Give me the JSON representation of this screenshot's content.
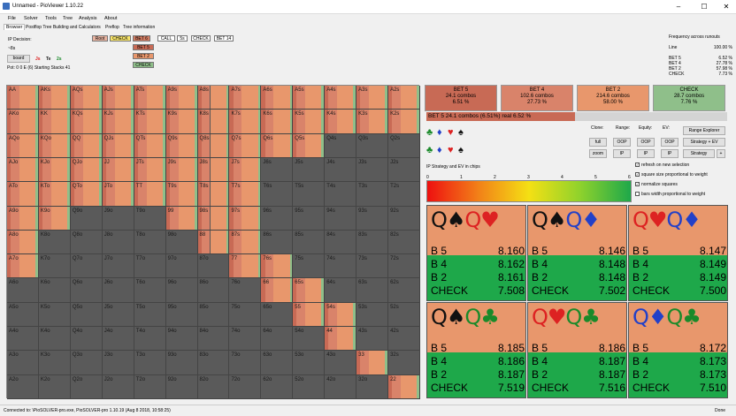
{
  "window": {
    "title": "Unnamed - PioViewer 1.10.22",
    "min": "–",
    "max": "☐",
    "close": "✕"
  },
  "menu": [
    "File",
    "Solver",
    "Tools",
    "Tree",
    "Analysis",
    "About"
  ],
  "tabs": [
    "Browser",
    "Postflop Tree Building and Calculators",
    "Preflop",
    "Tree information"
  ],
  "left_info": {
    "ip_decision": "IP Decision:",
    "path": "~8s",
    "board_btn": "board",
    "board_cards": [
      "Js",
      "Te",
      "2s"
    ],
    "pot": "Pot: 0 0 E (6) Starting Stacks 41"
  },
  "tree_chips": [
    {
      "label": "Root",
      "color": "#e8b3a0"
    },
    {
      "label": "CHECK",
      "color": "#f7e46a"
    },
    {
      "label": "BET 6",
      "color": "#d07a60"
    },
    {
      "label": "CALL",
      "color": "#ffffff"
    },
    {
      "label": "5s",
      "color": "#ffffff"
    },
    {
      "label": "CHECK",
      "color": "#ffffff"
    },
    {
      "label": "BET 14",
      "color": "#ffffff"
    }
  ],
  "tree_sub_chips": [
    {
      "label": "BET 5",
      "color": "#c86a55"
    },
    {
      "label": "BET 2",
      "color": "#e8976c"
    },
    {
      "label": "CHECK",
      "color": "#8fbf8a"
    }
  ],
  "freq": {
    "title": "Frequency across runouts",
    "line_label": "Line",
    "line_value": "100.00 %",
    "rows": [
      {
        "label": "BET 5",
        "value": "6.52 %"
      },
      {
        "label": "BET 4",
        "value": "27.78 %"
      },
      {
        "label": "BET 2",
        "value": "57.98 %"
      },
      {
        "label": "CHECK",
        "value": "7.73 %"
      }
    ]
  },
  "grid": {
    "ranks": [
      "A",
      "K",
      "Q",
      "J",
      "T",
      "9",
      "8",
      "7",
      "6",
      "5",
      "4",
      "3",
      "2"
    ],
    "cells": [
      [
        "AA",
        "AKs",
        "AQs",
        "AJs",
        "ATs",
        "A9s",
        "A8s",
        "A7s",
        "A6s",
        "A5s",
        "A4s",
        "A3s",
        "A2s"
      ],
      [
        "AKo",
        "KK",
        "KQs",
        "KJs",
        "KTs",
        "K9s",
        "K8s",
        "K7s",
        "K6s",
        "K5s",
        "K4s",
        "K3s",
        "K2s"
      ],
      [
        "AQo",
        "KQo",
        "QQ",
        "QJs",
        "QTs",
        "Q9s",
        "Q8s",
        "Q7s",
        "Q6s",
        "Q5s",
        "Q4s",
        "Q3s",
        "Q2s"
      ],
      [
        "AJo",
        "KJo",
        "QJo",
        "JJ",
        "JTs",
        "J9s",
        "J8s",
        "J7s",
        "J6s",
        "J5s",
        "J4s",
        "J3s",
        "J2s"
      ],
      [
        "ATo",
        "KTo",
        "QTo",
        "JTo",
        "TT",
        "T9s",
        "T8s",
        "T7s",
        "T6s",
        "T5s",
        "T4s",
        "T3s",
        "T2s"
      ],
      [
        "A9o",
        "K9o",
        "Q9o",
        "J9o",
        "T9o",
        "99",
        "98s",
        "97s",
        "96s",
        "95s",
        "94s",
        "93s",
        "92s"
      ],
      [
        "A8o",
        "K8o",
        "Q8o",
        "J8o",
        "T8o",
        "98o",
        "88",
        "87s",
        "86s",
        "85s",
        "84s",
        "83s",
        "82s"
      ],
      [
        "A7o",
        "K7o",
        "Q7o",
        "J7o",
        "T7o",
        "97o",
        "87o",
        "77",
        "76s",
        "75s",
        "74s",
        "73s",
        "72s"
      ],
      [
        "A6o",
        "K6o",
        "Q6o",
        "J6o",
        "T6o",
        "96o",
        "86o",
        "76o",
        "66",
        "65s",
        "64s",
        "63s",
        "62s"
      ],
      [
        "A5o",
        "K5o",
        "Q5o",
        "J5o",
        "T5o",
        "95o",
        "85o",
        "75o",
        "65o",
        "55",
        "54s",
        "53s",
        "52s"
      ],
      [
        "A4o",
        "K4o",
        "Q4o",
        "J4o",
        "T4o",
        "94o",
        "84o",
        "74o",
        "64o",
        "54o",
        "44",
        "43s",
        "42s"
      ],
      [
        "A3o",
        "K3o",
        "Q3o",
        "J3o",
        "T3o",
        "93o",
        "83o",
        "73o",
        "63o",
        "53o",
        "43o",
        "33",
        "32s"
      ],
      [
        "A2o",
        "K2o",
        "Q2o",
        "J2o",
        "T2o",
        "92o",
        "82o",
        "72o",
        "62o",
        "52o",
        "42o",
        "32o",
        "22"
      ]
    ],
    "fill": [
      [
        1,
        1,
        1,
        1,
        1,
        1,
        1,
        1,
        1,
        1,
        1,
        1,
        1
      ],
      [
        1,
        1,
        1,
        1,
        1,
        1,
        1,
        1,
        1,
        1,
        1,
        1,
        1
      ],
      [
        1,
        1,
        1,
        1,
        1,
        1,
        1,
        1,
        1,
        1,
        0,
        0,
        0
      ],
      [
        1,
        1,
        1,
        1,
        1,
        1,
        1,
        1,
        0,
        0,
        0,
        0,
        0
      ],
      [
        1,
        1,
        1,
        1,
        1,
        1,
        1,
        1,
        0,
        0,
        0,
        0,
        0
      ],
      [
        1,
        1,
        0,
        0,
        0,
        1,
        1,
        1,
        0,
        0,
        0,
        0,
        0
      ],
      [
        1,
        0,
        0,
        0,
        0,
        0,
        1,
        1,
        0,
        0,
        0,
        0,
        0
      ],
      [
        1,
        0,
        0,
        0,
        0,
        0,
        0,
        1,
        1,
        0,
        0,
        0,
        0
      ],
      [
        0,
        0,
        0,
        0,
        0,
        0,
        0,
        0,
        1,
        1,
        0,
        0,
        0
      ],
      [
        0,
        0,
        0,
        0,
        0,
        0,
        0,
        0,
        0,
        1,
        1,
        0,
        0
      ],
      [
        0,
        0,
        0,
        0,
        0,
        0,
        0,
        0,
        0,
        0,
        1,
        0,
        0
      ],
      [
        0,
        0,
        0,
        0,
        0,
        0,
        0,
        0,
        0,
        0,
        0,
        1,
        0
      ],
      [
        0,
        0,
        0,
        0,
        0,
        0,
        0,
        0,
        0,
        0,
        0,
        0,
        1
      ]
    ]
  },
  "actions": [
    {
      "name": "BET 5",
      "combos": "24.1 combos",
      "pct": "6.51 %",
      "color": "#c86a55"
    },
    {
      "name": "BET 4",
      "combos": "102.6 combos",
      "pct": "27.73 %",
      "color": "#d9836a"
    },
    {
      "name": "BET 2",
      "combos": "214.6 combos",
      "pct": "58.00 %",
      "color": "#e8976c"
    },
    {
      "name": "CHECK",
      "combos": "28.7 combos",
      "pct": "7.76 %",
      "color": "#8fbf8a"
    }
  ],
  "combo_bar": "BET 5   24.1 combos (6.51%) real  6.52 %",
  "controls": {
    "labels": [
      "Clone:",
      "Range:",
      "Equity:",
      "EV:"
    ],
    "full": "full",
    "zoom": "zoom",
    "oop1": "OOP",
    "ip1": "IP",
    "oop2": "OOP",
    "ip2": "IP",
    "oop3": "OOP",
    "ip3": "IP",
    "range_explorer": "Range Explorer",
    "strategy_ev": "Strategy + EV",
    "strategy": "Strategy",
    "plus": "+"
  },
  "gradient": {
    "caption": "IP Strategy and EV in chips",
    "ticks": [
      "0",
      "1",
      "2",
      "3",
      "4",
      "5",
      "6"
    ]
  },
  "checkboxes": [
    {
      "label": "refresh on new selection",
      "checked": "✓"
    },
    {
      "label": "square size proportional to weight",
      "checked": "✓"
    },
    {
      "label": "normalize squares",
      "checked": "✓"
    },
    {
      "label": "bars width proportional to weight",
      "checked": ""
    }
  ],
  "combos": [
    {
      "c1": "Q♠",
      "c2": "Q♥",
      "rows": [
        [
          "B 5",
          "8.160"
        ],
        [
          "B 4",
          "8.162"
        ],
        [
          "B 2",
          "8.161"
        ],
        [
          "CHECK",
          "7.508"
        ]
      ]
    },
    {
      "c1": "Q♠",
      "c2": "Q♦",
      "rows": [
        [
          "B 5",
          "8.146"
        ],
        [
          "B 4",
          "8.148"
        ],
        [
          "B 2",
          "8.148"
        ],
        [
          "CHECK",
          "7.502"
        ]
      ]
    },
    {
      "c1": "Q♥",
      "c2": "Q♦",
      "rows": [
        [
          "B 5",
          "8.147"
        ],
        [
          "B 4",
          "8.149"
        ],
        [
          "B 2",
          "8.149"
        ],
        [
          "CHECK",
          "7.500"
        ]
      ]
    },
    {
      "c1": "Q♠",
      "c2": "Q♣",
      "rows": [
        [
          "B 5",
          "8.185"
        ],
        [
          "B 4",
          "8.186"
        ],
        [
          "B 2",
          "8.187"
        ],
        [
          "CHECK",
          "7.519"
        ]
      ]
    },
    {
      "c1": "Q♥",
      "c2": "Q♣",
      "rows": [
        [
          "B 5",
          "8.186"
        ],
        [
          "B 4",
          "8.187"
        ],
        [
          "B 2",
          "8.187"
        ],
        [
          "CHECK",
          "7.516"
        ]
      ]
    },
    {
      "c1": "Q♦",
      "c2": "Q♣",
      "rows": [
        [
          "B 5",
          "8.172"
        ],
        [
          "B 4",
          "8.173"
        ],
        [
          "B 2",
          "8.173"
        ],
        [
          "CHECK",
          "7.510"
        ]
      ]
    }
  ],
  "status": {
    "left": "Connected to: \\PioSOLVER-pro.exe, PioSOLVER-pro 1.10.19 (Aug 8 2018, 10:58:25)",
    "right": "Done"
  }
}
